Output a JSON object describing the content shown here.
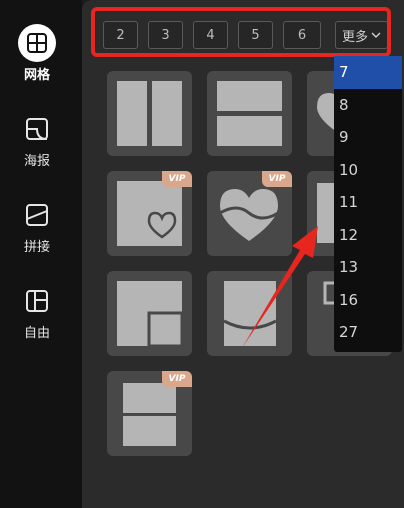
{
  "nav": {
    "items": [
      {
        "label": "网格",
        "icon": "grid-icon",
        "active": true
      },
      {
        "label": "海报",
        "icon": "poster-icon",
        "active": false
      },
      {
        "label": "拼接",
        "icon": "stitch-icon",
        "active": false
      },
      {
        "label": "自由",
        "icon": "freeform-icon",
        "active": false
      }
    ]
  },
  "counts": {
    "buttons": [
      "2",
      "3",
      "4",
      "5",
      "6"
    ],
    "more_label": "更多"
  },
  "dropdown": {
    "options": [
      "7",
      "8",
      "9",
      "10",
      "11",
      "12",
      "13",
      "16",
      "27"
    ],
    "selected": "7"
  },
  "vip_label": "VIP",
  "colors": {
    "highlight_box": "#e6261f",
    "arrow": "#e6261f",
    "selected_option": "#1f4fa8",
    "vip_badge": "#d9a78c",
    "tile_bg": "#484848",
    "tile_shape": "#b5b5b5"
  }
}
